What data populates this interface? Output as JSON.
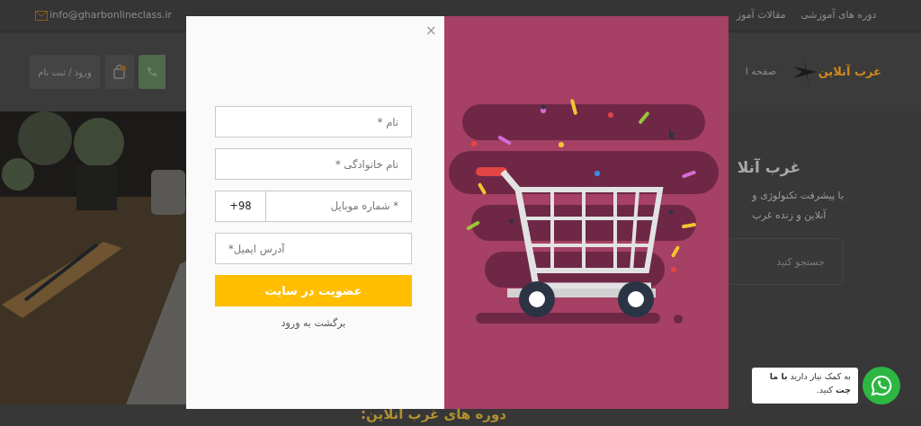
{
  "topbar": {
    "email": "info@gharbonlineclass.ir",
    "links": [
      "دوره های آموزشی",
      "مقالات آموز"
    ]
  },
  "header": {
    "logo": "غرب آنلاین",
    "nav": [
      "صفحه ا"
    ],
    "login": "ورود / ثبت نام"
  },
  "hero": {
    "title": "غرب آنلا",
    "lines": [
      "با پیشرفت تکنولوژی و",
      "آنلاین و زنده غرب"
    ],
    "search": {
      "placeholder": "جستجو کنید"
    }
  },
  "section_title": "دوره های غرب آنلاین:",
  "modal": {
    "close": "×",
    "fields": [
      {
        "kind": "text",
        "placeholder": "نام *"
      },
      {
        "kind": "text",
        "placeholder": "نام خانوادگی *"
      },
      {
        "kind": "phone",
        "prefix": "+98",
        "placeholder": "* شماره موبایل"
      },
      {
        "kind": "email",
        "placeholder": "*آدرس ایمیل"
      }
    ],
    "submit": "عضویت در سایت",
    "back_link": "برگشت به ورود"
  },
  "chat": {
    "text": "به کمک نیاز دارید **با ما چت** کنید."
  }
}
